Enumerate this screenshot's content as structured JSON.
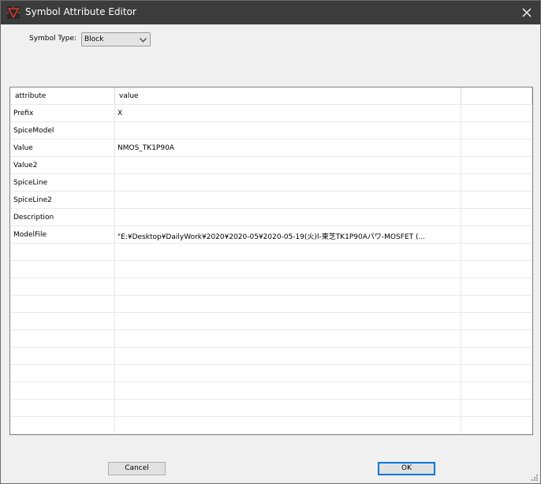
{
  "window": {
    "title": "Symbol Attribute Editor"
  },
  "symbol_type": {
    "label": "Symbol Type:",
    "selected": "Block"
  },
  "table": {
    "headers": [
      "attribute",
      "value"
    ],
    "rows": [
      {
        "attribute": "Prefix",
        "value": "X"
      },
      {
        "attribute": "SpiceModel",
        "value": ""
      },
      {
        "attribute": "Value",
        "value": "NMOS_TK1P90A"
      },
      {
        "attribute": "Value2",
        "value": ""
      },
      {
        "attribute": "SpiceLine",
        "value": ""
      },
      {
        "attribute": "SpiceLine2",
        "value": ""
      },
      {
        "attribute": "Description",
        "value": ""
      },
      {
        "attribute": "ModelFile",
        "value": "\"E:¥Desktop¥DailyWork¥2020¥2020-05¥2020-05-19(火)l-東芝TK1P90Aパワ-MOSFET (..."
      }
    ],
    "empty_rows": 11
  },
  "buttons": {
    "cancel": "Cancel",
    "ok": "OK"
  },
  "colors": {
    "titlebar": "#3c3c3c",
    "ok_border": "#0078d7",
    "icon_red": "#c0392b"
  },
  "icons": {
    "app": "ltspice-symbol-icon",
    "close": "close-icon",
    "dropdown": "chevron-down-icon"
  }
}
